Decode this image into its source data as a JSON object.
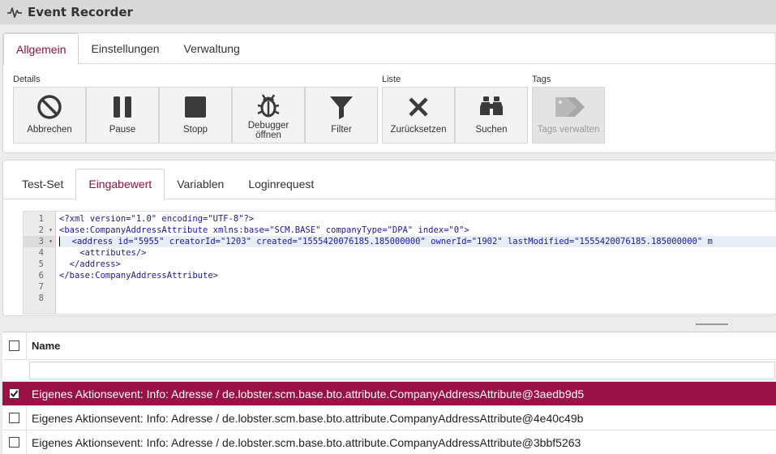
{
  "window": {
    "title": "Event Recorder",
    "icon": "activity-icon"
  },
  "top_tabs": [
    {
      "label": "Allgemein",
      "active": true
    },
    {
      "label": "Einstellungen",
      "active": false
    },
    {
      "label": "Verwaltung",
      "active": false
    }
  ],
  "toolbar": {
    "groups": {
      "details": "Details",
      "liste": "Liste",
      "tags": "Tags"
    },
    "buttons": {
      "abbrechen": {
        "label": "Abbrechen",
        "icon": "cancel-icon"
      },
      "pause": {
        "label": "Pause",
        "icon": "pause-icon"
      },
      "stopp": {
        "label": "Stopp",
        "icon": "stop-icon"
      },
      "debugger": {
        "label": "Debugger öffnen",
        "line1": "Debugger",
        "line2": "öffnen",
        "icon": "bug-icon"
      },
      "filter": {
        "label": "Filter",
        "icon": "funnel-icon"
      },
      "zuruecksetzen": {
        "label": "Zurücksetzen",
        "icon": "close-icon"
      },
      "suchen": {
        "label": "Suchen",
        "icon": "binoculars-icon"
      },
      "tags_verwalten": {
        "label": "Tags verwalten",
        "icon": "tags-icon",
        "disabled": true
      }
    }
  },
  "sub_tabs": [
    {
      "label": "Test-Set",
      "active": false
    },
    {
      "label": "Eingabewert",
      "active": true
    },
    {
      "label": "Variablen",
      "active": false
    },
    {
      "label": "Loginrequest",
      "active": false
    }
  ],
  "editor": {
    "current_line": 3,
    "line_numbers": [
      "1",
      "2",
      "3",
      "4",
      "5",
      "6",
      "7",
      "8"
    ],
    "lines": [
      "<?xml version=\"1.0\" encoding=\"UTF-8\"?>",
      "<base:CompanyAddressAttribute xmlns:base=\"SCM.BASE\" companyType=\"DPA\" index=\"0\">",
      "  <address id=\"5955\" creatorId=\"1203\" created=\"1555420076185.185000000\" ownerId=\"1902\" lastModified=\"1555420076185.185000000\" m",
      "    <attributes/>",
      "  </address>",
      "</base:CompanyAddressAttribute>",
      "",
      ""
    ]
  },
  "grid": {
    "header": "Name",
    "rows": [
      {
        "text": "Eigenes Aktionsevent: Info: Adresse / de.lobster.scm.base.bto.attribute.CompanyAddressAttribute@3aedb9d5",
        "checked": true,
        "selected": true
      },
      {
        "text": "Eigenes Aktionsevent: Info: Adresse / de.lobster.scm.base.bto.attribute.CompanyAddressAttribute@4e40c49b",
        "checked": false,
        "selected": false
      },
      {
        "text": "Eigenes Aktionsevent: Info: Adresse / de.lobster.scm.base.bto.attribute.CompanyAddressAttribute@3bbf5263",
        "checked": false,
        "selected": false
      }
    ]
  },
  "colors": {
    "accent": "#8c1340",
    "selected_row": "#9a1245"
  }
}
